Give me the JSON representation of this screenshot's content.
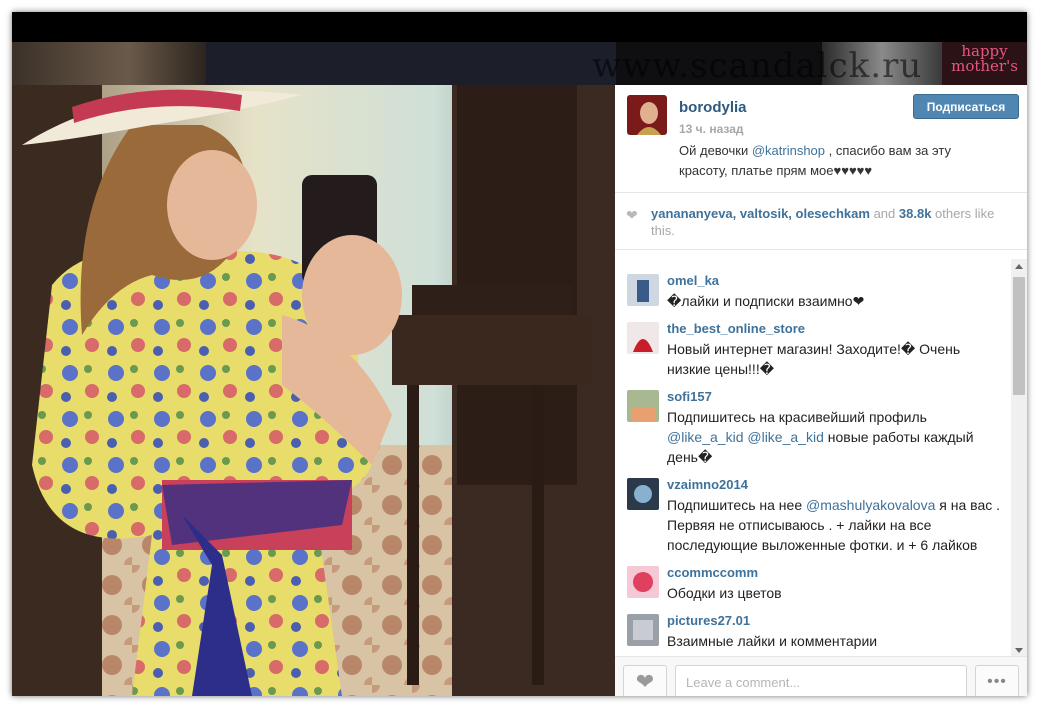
{
  "background": {
    "watermark": "www.scandalck.ru",
    "promo_text": "happy mother's"
  },
  "post": {
    "username": "borodylia",
    "time_ago": "13 ч. назад",
    "follow_label": "Подписаться",
    "caption_before": "Ой девочки ",
    "caption_mention": "@katrinshop",
    "caption_after": " , спасибо вам за эту красоту, платье прям мое♥♥♥♥♥"
  },
  "likes": {
    "users": "yanananyeva, valtosik, olesechkam",
    "and": " and ",
    "count": "38.8k",
    "suffix": " others like this."
  },
  "comments": [
    {
      "user": "omel_ka",
      "text": "�лайки и подписки взаимно❤"
    },
    {
      "user": "the_best_online_store",
      "text": "Новый интернет магазин! Заходите!� Очень низкие цены!!!�"
    },
    {
      "user": "sofi157",
      "text_before": "Подпишитесь на красивейший профиль ",
      "mention1": "@like_a_kid",
      "between": " ",
      "mention2": "@like_a_kid",
      "text_after": "  новые работы каждый день�"
    },
    {
      "user": "vzaimno2014",
      "text_before": "Подпишитесь на нее ",
      "mention": "@mashulyakovalova",
      "text_after": " я на вас . Первяя не отписываюсь . + лайки на все последующие выложенные фотки. и + 6 лайков"
    },
    {
      "user": "ccommccomm",
      "text": "Ободки из цветов"
    },
    {
      "user": "pictures27.01",
      "text": "Взаимные лайки и комментарии"
    }
  ],
  "footer": {
    "comment_placeholder": "Leave a comment...",
    "more_label": "•••"
  },
  "colors": {
    "link": "#3f729b",
    "follow_button": "#4f86b2"
  },
  "icons": [
    "heart-icon",
    "ellipsis-icon",
    "scroll-up-icon",
    "scroll-down-icon"
  ]
}
